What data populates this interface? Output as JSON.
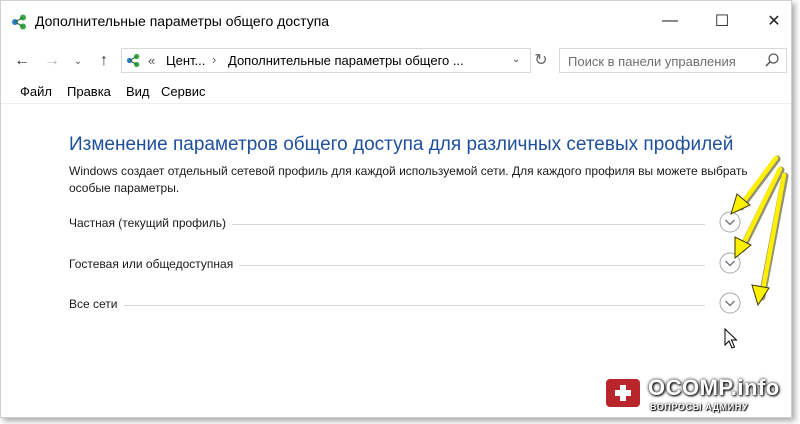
{
  "window": {
    "title": "Дополнительные параметры общего доступа",
    "minimize_glyph": "—",
    "maximize_glyph": "☐",
    "close_glyph": "✕"
  },
  "nav": {
    "back_glyph": "←",
    "forward_glyph": "→",
    "recent_glyph": "⌄",
    "up_glyph": "↑",
    "refresh_glyph": "↻"
  },
  "address": {
    "start_chevron": "«",
    "crumbs": [
      "Цент...",
      "Дополнительные параметры общего ..."
    ],
    "separator": "›",
    "dropdown_glyph": "⌄"
  },
  "search": {
    "placeholder": "Поиск в панели управления",
    "value": ""
  },
  "menu": [
    "Файл",
    "Правка",
    "Вид",
    "Сервис"
  ],
  "content": {
    "heading": "Изменение параметров общего доступа для различных сетевых профилей",
    "description": "Windows создает отдельный сетевой профиль для каждой используемой сети. Для каждого профиля вы можете выбрать особые параметры.",
    "sections": [
      {
        "label": "Частная (текущий профиль)",
        "expanded": false
      },
      {
        "label": "Гостевая или общедоступная",
        "expanded": false
      },
      {
        "label": "Все сети",
        "expanded": false
      }
    ]
  },
  "watermark": {
    "badge": "+",
    "title": "OCOMP.info",
    "subtitle": "ВОПРОСЫ АДМИНУ"
  },
  "colors": {
    "heading": "#1e4f9e",
    "annotation_arrow": "#ffef00",
    "watermark_badge": "#b8262c"
  },
  "icons": {
    "app": "network-sharing-icon",
    "search": "search-icon",
    "section_toggle": "chevron-down-circle-icon"
  }
}
